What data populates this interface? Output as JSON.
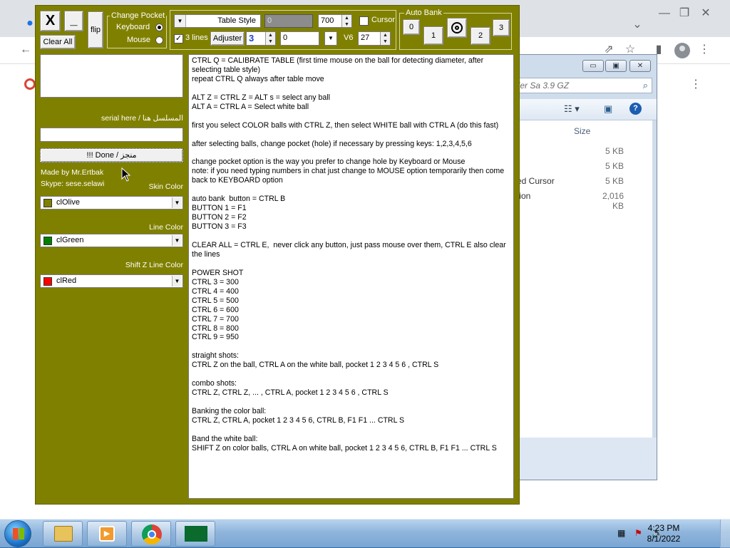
{
  "explorer": {
    "search_placeholder": "uler Sa 3.9 GZ",
    "col_size": "Size",
    "rows": [
      {
        "name": "",
        "size": "5 KB"
      },
      {
        "name": "",
        "size": "5 KB"
      },
      {
        "name": "ed Cursor",
        "size": "5 KB"
      },
      {
        "name": "tion",
        "size": "2,016 KB"
      }
    ]
  },
  "app": {
    "close_label": "X",
    "minimize_label": "_",
    "clear_all_label": "Clear All",
    "flip_label": "flip",
    "change_pocket": {
      "title": "Change Pocket",
      "options": [
        "Keyboard",
        "Mouse"
      ],
      "selected": "Keyboard"
    },
    "table_style_label": "Table Style",
    "field_a_value": "0",
    "field_b_value": "700",
    "cursor_label": "Cursor",
    "lines_label": "3 lines",
    "adjuster_label": "Adjuster",
    "adjuster_value": "3",
    "field_c_value": "0",
    "v6_label": "V6",
    "field_d_value": "27",
    "auto_bank": {
      "title": "Auto Bank",
      "buttons": [
        "0",
        "1",
        "2",
        "3"
      ],
      "target_icon": "target-icon"
    },
    "serial_label": "serial here / المسلسل هنا",
    "serial_value": "",
    "done_label": "!!! Done / منجز",
    "made_by": "Made by Mr.Ertbak",
    "skype": "Skype: sese.selawi",
    "skin_color_label": "Skin Color",
    "skin_color_value": "clOlive",
    "line_color_label": "Line Color",
    "line_color_value": "clGreen",
    "shiftz_color_label": "Shift Z Line Color",
    "shiftz_color_value": "clRed",
    "colors": {
      "olive": "#808000",
      "green": "#008000",
      "red": "#ff0000"
    },
    "help_lines": [
      "CTRL Q = CALIBRATE TABLE (first time mouse on the ball for detecting diameter, after selecting table style)",
      "repeat CTRL Q always after table move",
      "",
      "ALT Z = CTRL Z = ALT s = select any ball",
      "ALT A = CTRL A = Select white ball",
      "",
      "first you select COLOR balls with CTRL Z, then select WHITE ball with CTRL A (do this fast)",
      "",
      "after selecting balls, change pocket (hole) if necessary by pressing keys: 1,2,3,4,5,6",
      "",
      "change pocket option is the way you prefer to change hole by Keyboard or Mouse",
      "note: if you need typing numbers in chat just change to MOUSE option temporarily then come back to KEYBOARD option",
      "",
      "auto bank  button = CTRL B",
      "BUTTON 1 = F1",
      "BUTTON 2 = F2",
      "BUTTON 3 = F3",
      "",
      "CLEAR ALL = CTRL E,  never click any button, just pass mouse over them, CTRL E also clear the lines",
      "",
      "POWER SHOT",
      "CTRL 3 = 300",
      "CTRL 4 = 400",
      "CTRL 5 = 500",
      "CTRL 6 = 600",
      "CTRL 7 = 700",
      "CTRL 8 = 800",
      "CTRL 9 = 950",
      "",
      "straight shots:",
      "CTRL Z on the ball, CTRL A on the white ball, pocket 1 2 3 4 5 6 , CTRL S",
      "",
      "combo shots:",
      "CTRL Z, CTRL Z, ... , CTRL A, pocket 1 2 3 4 5 6 , CTRL S",
      "",
      "Banking the color ball:",
      "CTRL Z, CTRL A, pocket 1 2 3 4 5 6, CTRL B, F1 F1 ... CTRL S",
      "",
      "Band the white ball:",
      "SHIFT Z on color balls, CTRL A on white ball, pocket 1 2 3 4 5 6, CTRL B, F1 F1 ... CTRL S"
    ]
  },
  "taskbar": {
    "items": [
      "explorer-icon",
      "media-player-icon",
      "chrome-icon",
      "flag-app-icon"
    ],
    "time": "4:23 PM",
    "date": "8/1/2022"
  }
}
